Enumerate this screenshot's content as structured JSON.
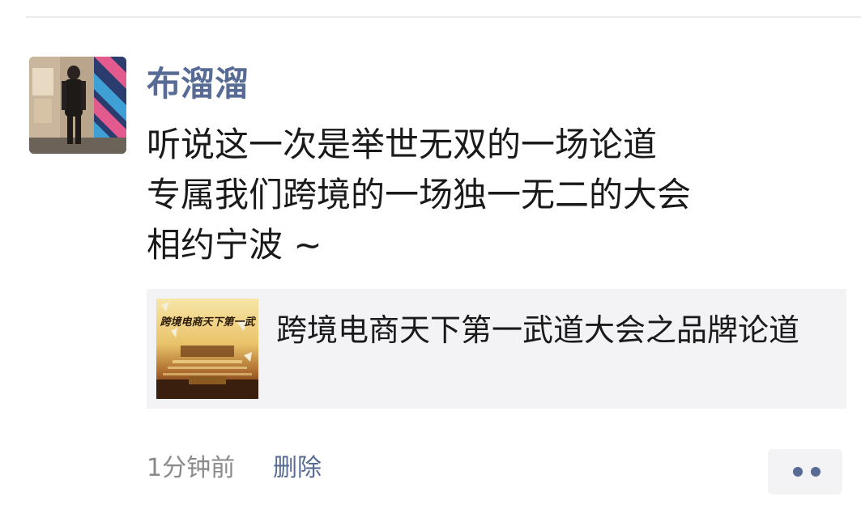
{
  "post": {
    "author": "布溜溜",
    "content_lines": [
      "听说这一次是举世无双的一场论道",
      "专属我们跨境的一场独一无二的大会",
      "相约宁波 ~"
    ],
    "link_card": {
      "thumbnail_text": "跨境电商天下第一武",
      "title": "跨境电商天下第一武道大会之品牌论道"
    },
    "time": "1分钟前",
    "delete_label": "删除",
    "more_icon": "more-dots-icon"
  },
  "colors": {
    "name_link": "#576b95",
    "text": "#1a1a1a",
    "meta": "#8a8a8a",
    "card_bg": "#f3f3f5"
  }
}
